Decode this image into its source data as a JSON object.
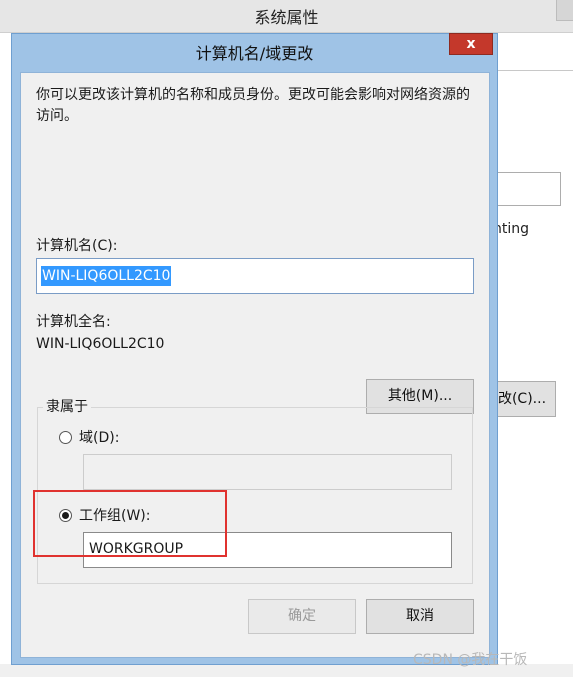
{
  "background_window": {
    "title": "系统属性",
    "partial_text": "nting",
    "partial_button": "改(C)..."
  },
  "dialog": {
    "title": "计算机名/域更改",
    "close_label": "x",
    "description": "你可以更改该计算机的名称和成员身份。更改可能会影响对网络资源的访问。",
    "computer_name_label": "计算机名(C):",
    "computer_name_value": "WIN-LIQ6OLL2C10",
    "full_name_label": "计算机全名:",
    "full_name_value": "WIN-LIQ6OLL2C10",
    "more_button": "其他(M)...",
    "member_of": {
      "legend": "隶属于",
      "domain_label": "域(D):",
      "domain_value": "",
      "domain_checked": false,
      "workgroup_label": "工作组(W):",
      "workgroup_value": "WORKGROUP",
      "workgroup_checked": true
    },
    "ok_button": "确定",
    "ok_disabled": true,
    "cancel_button": "取消"
  },
  "watermark": "CSDN @我在干饭",
  "colors": {
    "close_button": "#c4382b",
    "selection": "#3399ff",
    "highlight_box": "#e0322f",
    "dialog_frame": "#9fc3e6"
  }
}
